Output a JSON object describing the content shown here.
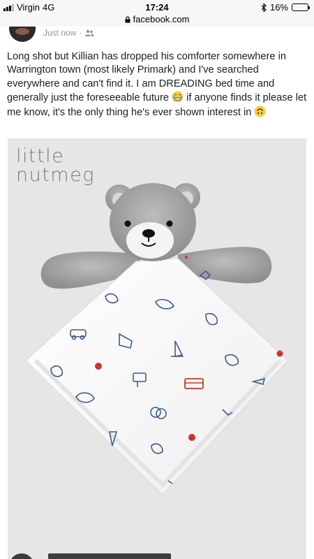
{
  "status_bar": {
    "carrier": "Virgin",
    "network": "4G",
    "time": "17:24",
    "battery_percent": "16%",
    "battery_level": 0.16,
    "battery_color": "#e8332c"
  },
  "url_bar": {
    "domain": "facebook.com"
  },
  "post": {
    "timestamp": "Just now",
    "separator": "·",
    "audience_icon": "friends-icon",
    "text_part1": "Long shot but Killian has dropped his comforter somewhere in Warrington town (most likely Primark) and I've searched everywhere and can't find it. I am DREADING bed time and generally just the foreseeable future",
    "emoji1": "grimacing-tears-emoji",
    "text_part2": " if anyone finds it please let me know, it's the only thing he's ever shown interest in",
    "emoji2": "upside-down-face-emoji"
  },
  "photo": {
    "brand_line1": "little",
    "brand_line2": "nutmeg",
    "subject": "grey teddy bear comforter with white patterned blanket"
  }
}
